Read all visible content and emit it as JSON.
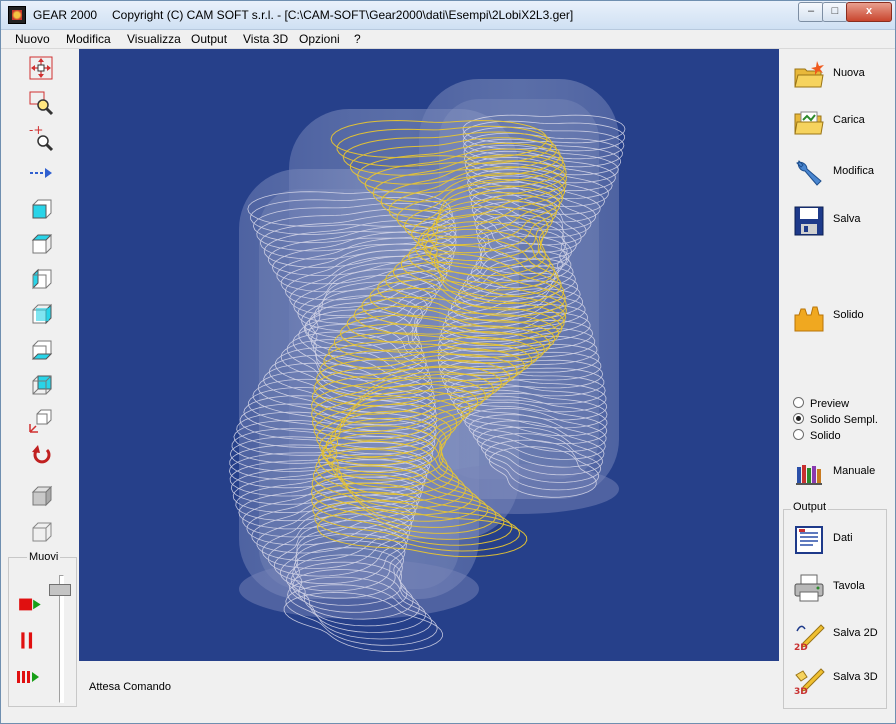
{
  "window": {
    "app_name": "GEAR 2000",
    "title": "Copyright (C)  CAM SOFT s.r.l. - [C:\\CAM-SOFT\\Gear2000\\dati\\Esempi\\2LobiX2L3.ger]",
    "min_glyph": "–",
    "max_glyph": "□",
    "close_glyph": "x"
  },
  "menu": [
    "Nuovo",
    "Modifica",
    "Visualizza",
    "Output",
    "Vista 3D",
    "Opzioni",
    "?"
  ],
  "left_toolbar": {
    "tools": [
      "pan-tool",
      "zoom-window-tool",
      "zoom-in-out-tool",
      "move-arrow-tool",
      "view-front-tool",
      "view-top-tool",
      "view-left-tool",
      "view-right-tool",
      "view-bottom-tool",
      "view-back-tool",
      "view-iso-tool",
      "rotate-tool",
      "solid-view-tool",
      "wireframe-view-tool"
    ],
    "muovi_label": "Muovi"
  },
  "status": "Attesa Comando",
  "right_panel": {
    "buttons": [
      "Nuova",
      "Carica",
      "Modifica",
      "Salva",
      "Solido"
    ],
    "radios": [
      {
        "label": "Preview",
        "selected": false
      },
      {
        "label": "Solido Sempl.",
        "selected": true
      },
      {
        "label": "Solido",
        "selected": false
      }
    ],
    "manuale": "Manuale",
    "output_label": "Output",
    "output_buttons": [
      "Dati",
      "Tavola",
      "Salva 2D",
      "Salva 3D"
    ]
  },
  "colors": {
    "viewport_bg": "#26408a",
    "gear_yellow": "#e8c531",
    "gear_white": "#dcdcec"
  }
}
